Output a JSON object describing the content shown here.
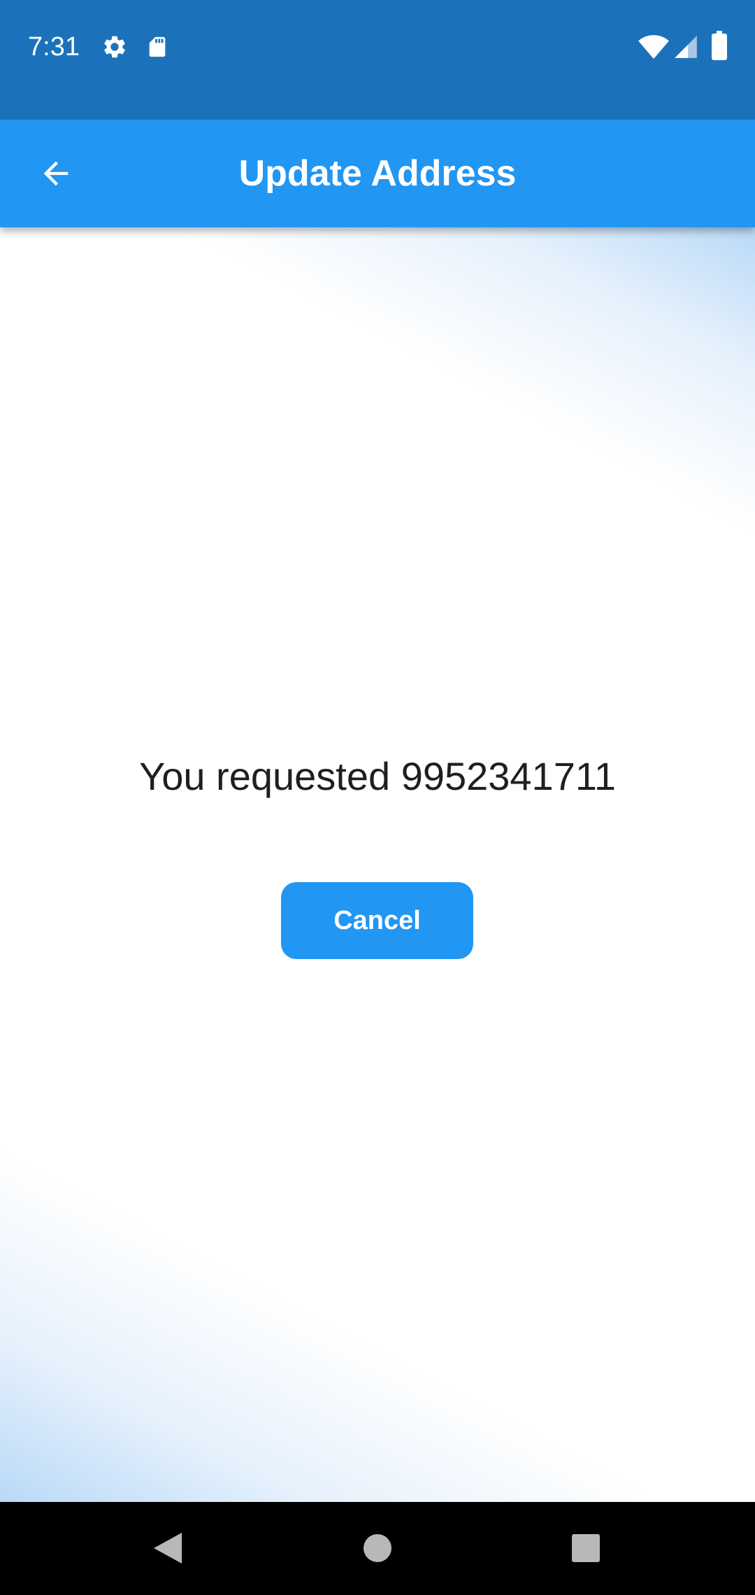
{
  "status_bar": {
    "time": "7:31",
    "left_icons": [
      "gear-icon",
      "sd-card-icon"
    ],
    "right_icons": [
      "wifi-icon",
      "cellular-signal-icon",
      "battery-icon"
    ],
    "background_color": "#1b72ba"
  },
  "app_bar": {
    "title": "Update Address",
    "back_icon": "arrow-left-icon",
    "background_color": "#2196f3"
  },
  "main": {
    "message": "You requested 9952341711",
    "cancel_label": "Cancel",
    "accent_color": "#2196f3"
  },
  "nav_bar": {
    "buttons": [
      "back-triangle-icon",
      "home-circle-icon",
      "recents-square-icon"
    ]
  }
}
